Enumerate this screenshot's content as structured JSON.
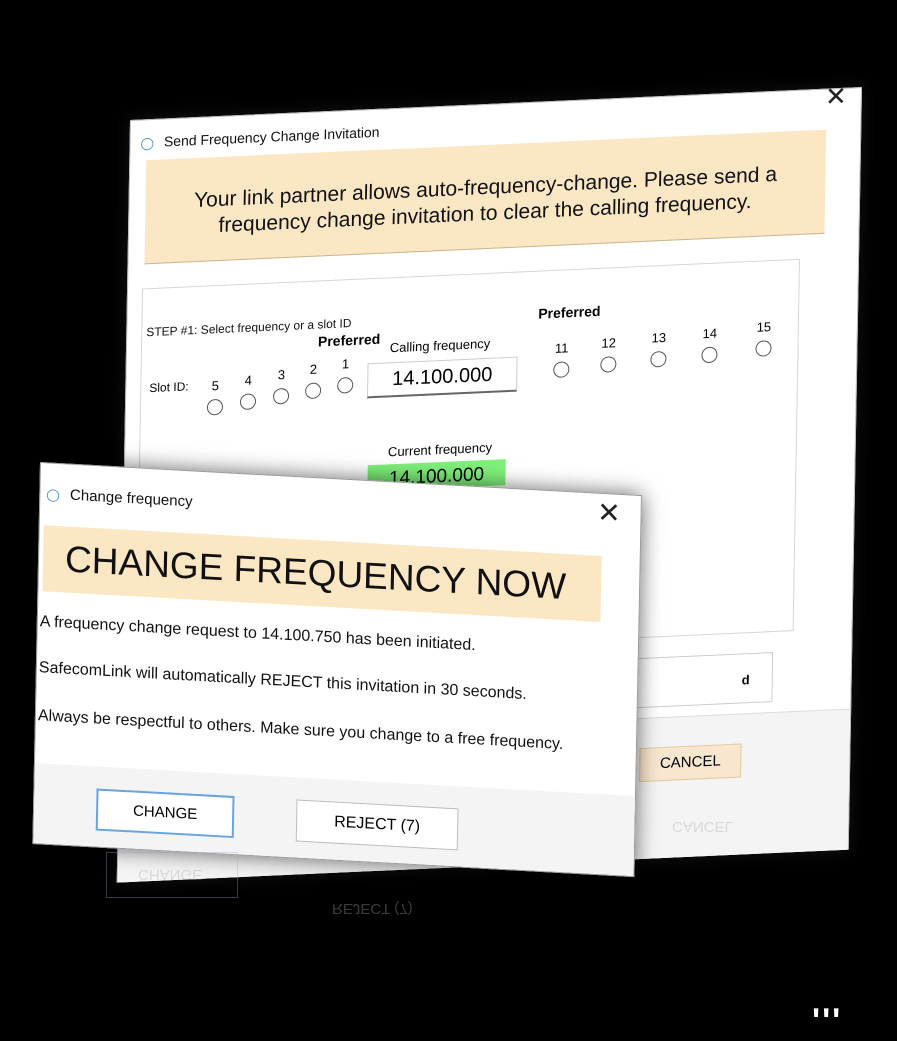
{
  "back_dialog": {
    "title": "Send Frequency Change Invitation",
    "close": "✕",
    "banner_line1": "Your link partner allows auto-frequency-change. Please send a",
    "banner_line2": "frequency change invitation to clear the calling frequency.",
    "step_label": "STEP #1: Select frequency or a slot ID",
    "preferred_left": "Preferred",
    "preferred_right": "Preferred",
    "slot_id_label": "Slot ID:",
    "slots_left": [
      "5",
      "4",
      "3",
      "2",
      "1"
    ],
    "slots_right": [
      "11",
      "12",
      "13",
      "14",
      "15"
    ],
    "calling_label": "Calling frequency",
    "calling_value": "14.100.000",
    "current_label": "Current frequency",
    "current_value": "14.100.000",
    "field_fragment": "d",
    "cancel_label": "CANCEL"
  },
  "front_dialog": {
    "title": "Change frequency",
    "close": "✕",
    "banner": "CHANGE FREQUENCY NOW",
    "msg1": "A frequency change request to 14.100.750 has been initiated.",
    "msg2": "SafecomLink will automatically REJECT this invitation in 30 seconds.",
    "msg3": "Always be respectful to others. Make sure you change to a free frequency.",
    "change_label": "CHANGE",
    "reject_label": "REJECT (7)"
  },
  "reflection": {
    "change": "CHANGE",
    "reject": "REJECT (7)",
    "cancel": "CANCEL"
  },
  "corner_glyphs": "ʹʹʹ"
}
